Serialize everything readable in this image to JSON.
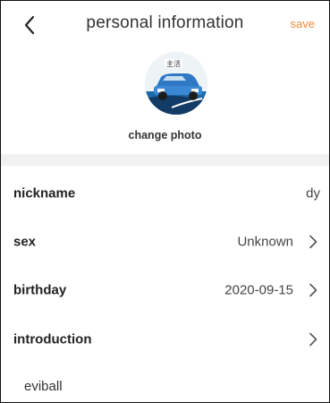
{
  "header": {
    "title": "personal information",
    "save_label": "save",
    "back_icon": "chevron-left-icon"
  },
  "profile": {
    "avatar_icon": "car-photo",
    "change_photo_label": "change photo"
  },
  "rows": [
    {
      "label": "nickname",
      "value": "dy",
      "has_arrow": false
    },
    {
      "label": "sex",
      "value": "Unknown",
      "has_arrow": true
    },
    {
      "label": "birthday",
      "value": "2020-09-15",
      "has_arrow": true
    },
    {
      "label": "introduction",
      "value": "",
      "has_arrow": true
    }
  ],
  "introduction_text": "eviball",
  "colors": {
    "accent": "#f08a3c",
    "divider": "#f1f1f1",
    "text": "#222222"
  }
}
